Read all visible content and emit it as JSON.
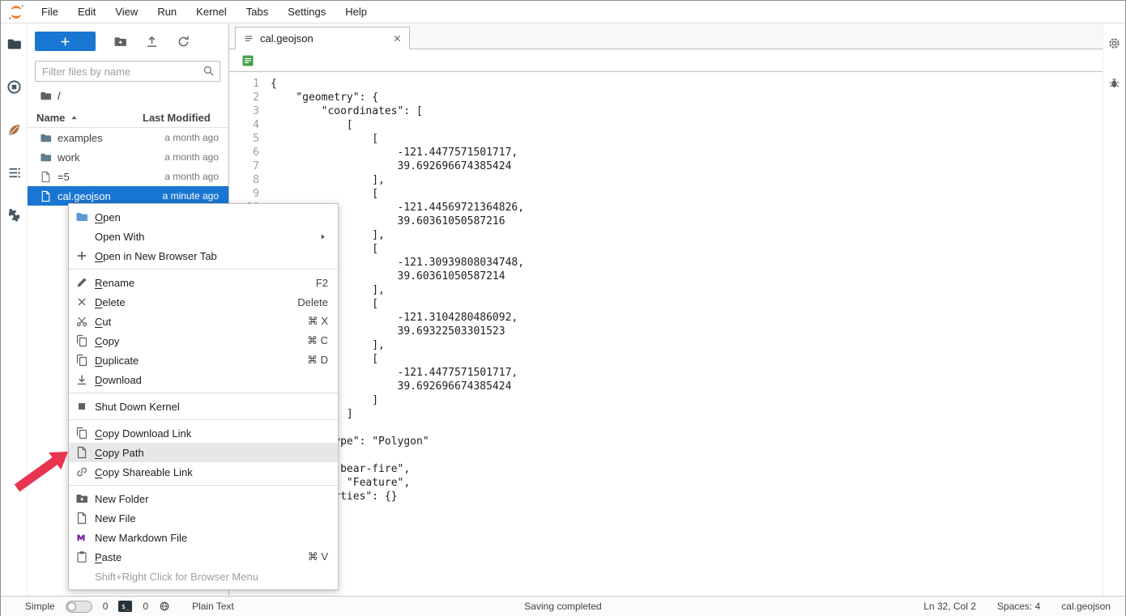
{
  "menubar": {
    "items": [
      "File",
      "Edit",
      "View",
      "Run",
      "Kernel",
      "Tabs",
      "Settings",
      "Help"
    ]
  },
  "left_sidebar": {
    "items": [
      {
        "icon": "folder",
        "name": "file-browser-tab",
        "color": "#37474f"
      },
      {
        "icon": "stop-circle",
        "name": "running-sessions-tab",
        "color": "#455a64"
      },
      {
        "icon": "leaf",
        "name": "leaf-extension-tab",
        "color": "#a9703f"
      },
      {
        "icon": "toc",
        "name": "table-of-contents-tab",
        "color": "#455a64"
      },
      {
        "icon": "puzzle",
        "name": "extension-manager-tab",
        "color": "#455a64"
      }
    ]
  },
  "right_sidebar": {
    "items": [
      {
        "icon": "gear",
        "name": "property-inspector-tab",
        "color": "#616161"
      },
      {
        "icon": "bug",
        "name": "debugger-tab",
        "color": "#616161"
      }
    ]
  },
  "file_browser": {
    "filter_placeholder": "Filter files by name",
    "breadcrumb_root": "/",
    "columns": {
      "name": "Name",
      "modified": "Last Modified"
    },
    "files": [
      {
        "name": "examples",
        "icon": "folder",
        "modified": "a month ago",
        "selected": false
      },
      {
        "name": "work",
        "icon": "folder",
        "modified": "a month ago",
        "selected": false
      },
      {
        "name": "=5",
        "icon": "file",
        "modified": "a month ago",
        "selected": false
      },
      {
        "name": "cal.geojson",
        "icon": "file",
        "modified": "a minute ago",
        "selected": true
      }
    ]
  },
  "context_menu": {
    "items": [
      {
        "type": "item",
        "icon": "folder",
        "icon_color": "#5b9bd5",
        "label": "Open",
        "underline": true
      },
      {
        "type": "item",
        "icon": "none",
        "label": "Open With",
        "submenu": true
      },
      {
        "type": "item",
        "icon": "plus",
        "label": "Open in New Browser Tab",
        "underline": true
      },
      {
        "type": "divider"
      },
      {
        "type": "item",
        "icon": "pencil",
        "label": "Rename",
        "shortcut": "F2",
        "underline": true
      },
      {
        "type": "item",
        "icon": "close",
        "label": "Delete",
        "shortcut": "Delete",
        "underline": true
      },
      {
        "type": "item",
        "icon": "scissors",
        "label": "Cut",
        "shortcut": "⌘ X",
        "underline": true
      },
      {
        "type": "item",
        "icon": "copy",
        "label": "Copy",
        "shortcut": "⌘ C",
        "underline": true
      },
      {
        "type": "item",
        "icon": "copy",
        "label": "Duplicate",
        "shortcut": "⌘ D",
        "underline": true
      },
      {
        "type": "item",
        "icon": "download",
        "label": "Download",
        "underline": true
      },
      {
        "type": "divider"
      },
      {
        "type": "item",
        "icon": "stop",
        "label": "Shut Down Kernel"
      },
      {
        "type": "divider"
      },
      {
        "type": "item",
        "icon": "copy",
        "label": "Copy Download Link",
        "underline": true
      },
      {
        "type": "item",
        "icon": "file",
        "label": "Copy Path",
        "highlighted": true,
        "underline": true
      },
      {
        "type": "item",
        "icon": "link",
        "label": "Copy Shareable Link",
        "underline": true
      },
      {
        "type": "divider"
      },
      {
        "type": "item",
        "icon": "folder-plus",
        "label": "New Folder"
      },
      {
        "type": "item",
        "icon": "file",
        "label": "New File"
      },
      {
        "type": "item",
        "icon": "markdown",
        "icon_color": "#7b1fa2",
        "label": "New Markdown File"
      },
      {
        "type": "item",
        "icon": "paste",
        "label": "Paste",
        "shortcut": "⌘ V",
        "underline": true
      },
      {
        "type": "hint",
        "label": "Shift+Right Click for Browser Menu"
      }
    ]
  },
  "editor": {
    "tab": {
      "title": "cal.geojson"
    },
    "lines": [
      "{",
      "    \"geometry\": {",
      "        \"coordinates\": [",
      "            [",
      "                [",
      "                    -121.4477571501717,",
      "                    39.692696674385424",
      "                ],",
      "                [",
      "                    -121.44569721364826,",
      "                    39.60361050587216",
      "                ],",
      "                [",
      "                    -121.30939808034748,",
      "                    39.60361050587214",
      "                ],",
      "                [",
      "                    -121.3104280486092,",
      "                    39.69322503301523",
      "                ],",
      "                [",
      "                    -121.4477571501717,",
      "                    39.692696674385424",
      "                ]",
      "            ]",
      "        ],",
      "        \"type\": \"Polygon\"",
      "    },",
      "    \"id\": \"bear-fire\",",
      "    \"type\": \"Feature\",",
      "    \"properties\": {}",
      "}"
    ]
  },
  "status_bar": {
    "simple_label": "Simple",
    "terminal_count": "0",
    "kernel_count": "0",
    "terminal_glyph": "$_",
    "mode": "Plain Text",
    "message": "Saving completed",
    "cursor": "Ln 32, Col 2",
    "spaces": "Spaces: 4",
    "filename": "cal.geojson"
  },
  "colors": {
    "brand": "#1976d2",
    "green": "#43a047",
    "purple": "#7b1fa2",
    "orange": "#f37726",
    "red": "#e8344e",
    "icon": "#616161",
    "folder": "#607d8b"
  }
}
